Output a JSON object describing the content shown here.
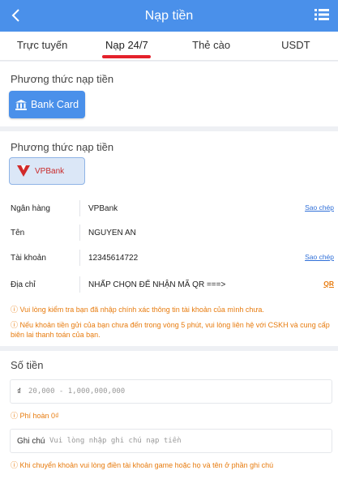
{
  "header": {
    "title": "Nạp tiền"
  },
  "tabs": [
    {
      "label": "Trực tuyến"
    },
    {
      "label": "Nạp 24/7"
    },
    {
      "label": "Thẻ cào"
    },
    {
      "label": "USDT"
    }
  ],
  "method_section": {
    "label": "Phương thức nạp tiền",
    "button_label": "Bank Card"
  },
  "bank_section": {
    "label": "Phương thức nạp tiền",
    "bank_name": "VPBank"
  },
  "details": [
    {
      "label": "Ngân hàng",
      "value": "VPBank",
      "action": "Sao chép"
    },
    {
      "label": "Tên",
      "value": "NGUYEN AN",
      "action": ""
    },
    {
      "label": "Tài khoản",
      "value": "12345614722",
      "action": "Sao chép"
    },
    {
      "label": "Địa chỉ",
      "value": "NHẤP CHỌN ĐỂ NHẬN MÃ QR ===>",
      "action": "QR"
    }
  ],
  "notes": {
    "note1": "Vui lòng kiểm tra bạn đã nhập chính xác thông tin tài khoản của mình chưa.",
    "note2": "Nếu khoản tiền gửi của bạn chưa đến trong vòng 5 phút, vui lòng liên hệ với CSKH và cung cấp biên lai thanh toán của bạn."
  },
  "amount": {
    "label": "Số tiền",
    "currency": "₫",
    "placeholder": "20,000 - 1,000,000,000",
    "fee": "Phí hoàn 0₫"
  },
  "memo": {
    "label": "Ghi chú",
    "placeholder": "Vui lòng nhập ghi chú nạp tiền",
    "hint": "Khi chuyển khoản vui lòng điền tài khoản game hoặc họ và tên ở phần ghi chú"
  },
  "colors": {
    "header_bg": "#4a90ea",
    "tab_indicator": "#e4212b",
    "warning": "#e77b0e",
    "link": "#2f6fd8"
  },
  "icons": {
    "back": "chevron-left-icon",
    "menu": "list-menu-icon",
    "bank": "bank-building-icon",
    "vpbank": "vpbank-logo-icon",
    "info": "info-circle-icon"
  }
}
